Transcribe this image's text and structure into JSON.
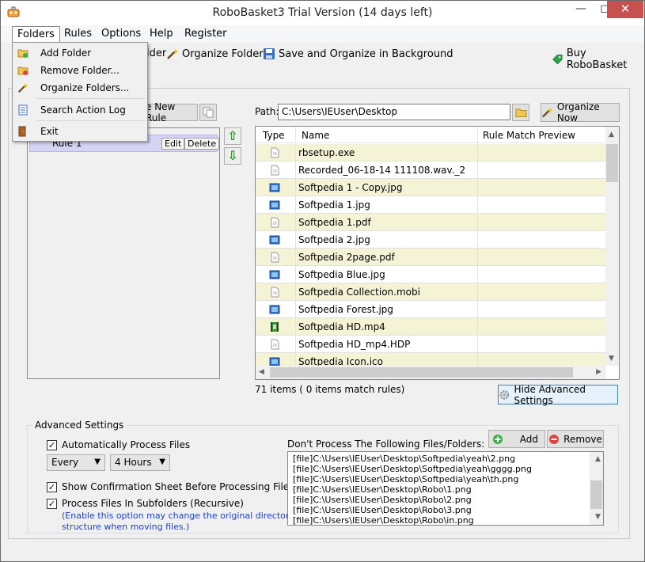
{
  "window": {
    "title": "RoboBasket3 Trial Version (14 days left)"
  },
  "menu": {
    "items": [
      "Folders",
      "Rules",
      "Options",
      "Help",
      "Register"
    ],
    "folders_dropdown": [
      "Add Folder",
      "Remove Folder...",
      "Organize Folders...",
      "Search Action Log",
      "Exit"
    ]
  },
  "toolbar": {
    "add_folder_partial": "lder",
    "organize_folders": "Organize Folders",
    "save_and_organize": "Save and Organize in Background",
    "buy": "Buy RoboBasket"
  },
  "rules": {
    "new_rule_partial": "e New Rule",
    "rule_name_partial": "Rule 1",
    "edit": "Edit",
    "delete": "Delete"
  },
  "path": {
    "label": "Path:",
    "value": "C:\\Users\\IEUser\\Desktop"
  },
  "organize_now": "Organize Now",
  "files": {
    "columns": [
      "Type",
      "Name",
      "Rule Match Preview"
    ],
    "rows": [
      {
        "name": "rbsetup.exe",
        "type_icon": "generic-file-icon",
        "highlight": true
      },
      {
        "name": "Recorded_06-18-14 111108.wav._2",
        "type_icon": "generic-file-icon",
        "highlight": false
      },
      {
        "name": "Softpedia 1 - Copy.jpg",
        "type_icon": "image-file-icon",
        "highlight": true
      },
      {
        "name": "Softpedia 1.jpg",
        "type_icon": "image-file-icon",
        "highlight": false
      },
      {
        "name": "Softpedia 1.pdf",
        "type_icon": "generic-file-icon",
        "highlight": true
      },
      {
        "name": "Softpedia 2.jpg",
        "type_icon": "image-file-icon",
        "highlight": false
      },
      {
        "name": "Softpedia 2page.pdf",
        "type_icon": "generic-file-icon",
        "highlight": true
      },
      {
        "name": "Softpedia Blue.jpg",
        "type_icon": "image-file-icon",
        "highlight": false
      },
      {
        "name": "Softpedia Collection.mobi",
        "type_icon": "generic-file-icon",
        "highlight": true
      },
      {
        "name": "Softpedia Forest.jpg",
        "type_icon": "image-file-icon",
        "highlight": false
      },
      {
        "name": "Softpedia HD.mp4",
        "type_icon": "video-file-icon",
        "highlight": true
      },
      {
        "name": "Softpedia HD_mp4.HDP",
        "type_icon": "generic-file-icon",
        "highlight": false
      },
      {
        "name": "Softpedia Icon.ico",
        "type_icon": "image-file-icon",
        "highlight": true
      }
    ],
    "count_text": "71 items ( 0 items match rules)"
  },
  "hide_advanced": "Hide Advanced Settings",
  "advanced": {
    "title": "Advanced Settings",
    "auto_process": "Automatically Process Files",
    "every": "Every",
    "interval": "4 Hours",
    "show_confirmation": "Show Confirmation Sheet Before Processing Files",
    "process_subfolders": "Process Files In Subfolders (Recursive)",
    "note_line1": "(Enable this option may change the original directory",
    "note_line2": "structure when moving files.)",
    "exclude_label": "Don't Process The Following Files/Folders:",
    "add": "Add",
    "remove": "Remove",
    "exclusions": [
      "[file]C:\\Users\\IEUser\\Desktop\\Softpedia\\yeah\\2.png",
      "[file]C:\\Users\\IEUser\\Desktop\\Softpedia\\yeah\\gggg.png",
      "[file]C:\\Users\\IEUser\\Desktop\\Softpedia\\yeah\\th.png",
      "[file]C:\\Users\\IEUser\\Desktop\\Robo\\1.png",
      "[file]C:\\Users\\IEUser\\Desktop\\Robo\\2.png",
      "[file]C:\\Users\\IEUser\\Desktop\\Robo\\3.png",
      "[file]C:\\Users\\IEUser\\Desktop\\Robo\\in.png"
    ]
  }
}
